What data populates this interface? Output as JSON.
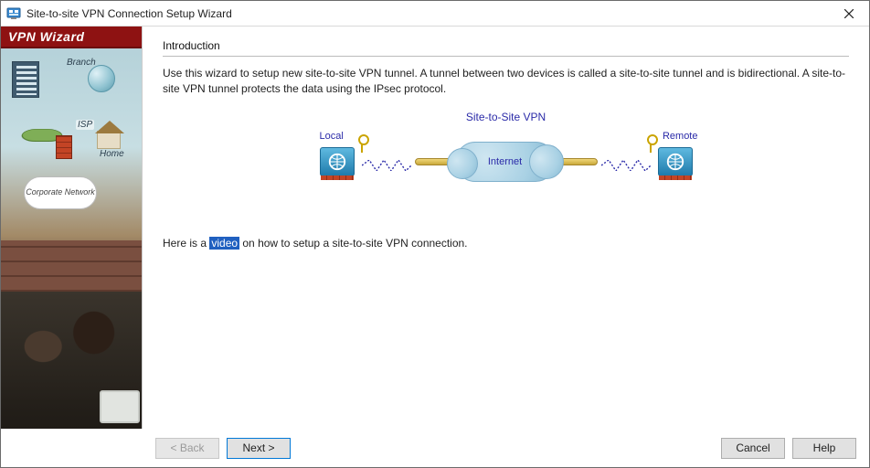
{
  "window": {
    "title": "Site-to-site VPN Connection Setup Wizard"
  },
  "sidebar": {
    "header": "VPN Wizard",
    "labels": {
      "branch": "Branch",
      "isp": "ISP",
      "home": "Home",
      "corporate": "Corporate Network"
    }
  },
  "main": {
    "section_title": "Introduction",
    "intro_text": "Use this wizard to setup new site-to-site VPN tunnel. A tunnel between two devices is called a site-to-site tunnel and is bidirectional. A site-to-site VPN tunnel protects the data using the IPsec protocol.",
    "diagram": {
      "title": "Site-to-Site VPN",
      "local": "Local",
      "remote": "Remote",
      "internet": "Internet"
    },
    "video_line_prefix": "Here is a ",
    "video_link_text": "video",
    "video_line_suffix": " on how to setup a site-to-site VPN connection."
  },
  "footer": {
    "back": "< Back",
    "next": "Next >",
    "cancel": "Cancel",
    "help": "Help"
  }
}
